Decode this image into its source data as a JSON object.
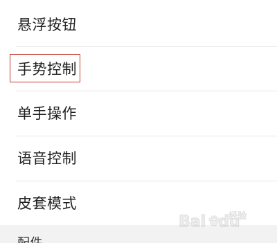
{
  "settings": {
    "items": [
      {
        "label": "悬浮按钮"
      },
      {
        "label": "手势控制"
      },
      {
        "label": "单手操作"
      },
      {
        "label": "语音控制"
      },
      {
        "label": "皮套模式"
      }
    ],
    "highlighted_index": 1,
    "highlight_color": "#c0392b"
  },
  "section": {
    "label": "配件"
  },
  "watermark": {
    "brand": "Bai",
    "brand_suffix": "du",
    "sub": "经验",
    "sub_line2": ""
  }
}
